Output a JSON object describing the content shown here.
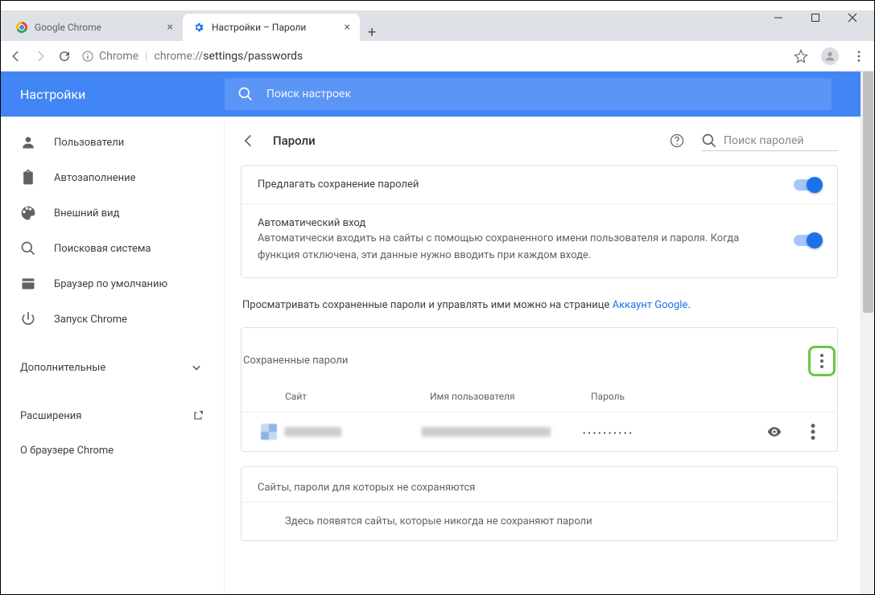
{
  "window": {
    "tabs": [
      {
        "label": "Google Chrome"
      },
      {
        "label": "Настройки – Пароли"
      }
    ],
    "url_chip": "Chrome",
    "url_scheme": "chrome://",
    "url_path": "settings/passwords"
  },
  "blue_header": {
    "title": "Настройки",
    "search_placeholder": "Поиск настроек"
  },
  "sidebar": {
    "items": [
      {
        "label": "Пользователи"
      },
      {
        "label": "Автозаполнение"
      },
      {
        "label": "Внешний вид"
      },
      {
        "label": "Поисковая система"
      },
      {
        "label": "Браузер по умолчанию"
      },
      {
        "label": "Запуск Chrome"
      }
    ],
    "advanced": "Дополнительные",
    "extensions": "Расширения",
    "about": "О браузере Chrome"
  },
  "page": {
    "title": "Пароли",
    "search_placeholder": "Поиск паролей",
    "offer_save": "Предлагать сохранение паролей",
    "auto_signin_title": "Автоматический вход",
    "auto_signin_desc": "Автоматически входить на сайты с помощью сохраненного имени пользователя и пароля. Когда функция отключена, эти данные нужно вводить при каждом входе.",
    "manage_note_pre": "Просматривать сохраненные пароли и управлять ими можно на странице ",
    "manage_note_link": "Аккаунт Google",
    "saved_title": "Сохраненные пароли",
    "columns": {
      "site": "Сайт",
      "user": "Имя пользователя",
      "pass": "Пароль"
    },
    "password_row": {
      "masked": "••••••••••"
    },
    "never_title": "Сайты, пароли для которых не сохраняются",
    "never_empty": "Здесь появятся сайты, которые никогда не сохраняют пароли"
  }
}
